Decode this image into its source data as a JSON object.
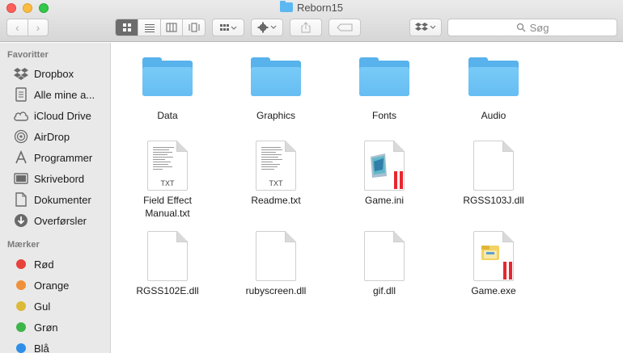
{
  "window": {
    "title": "Reborn15"
  },
  "toolbar": {
    "search_placeholder": "Søg",
    "back_icon": "chevron-left-icon",
    "forward_icon": "chevron-right-icon"
  },
  "sidebar": {
    "favorites_header": "Favoritter",
    "favorites": [
      {
        "label": "Dropbox",
        "icon": "dropbox-icon"
      },
      {
        "label": "Alle mine a...",
        "icon": "all-files-icon"
      },
      {
        "label": "iCloud Drive",
        "icon": "cloud-icon"
      },
      {
        "label": "AirDrop",
        "icon": "airdrop-icon"
      },
      {
        "label": "Programmer",
        "icon": "applications-icon"
      },
      {
        "label": "Skrivebord",
        "icon": "desktop-icon"
      },
      {
        "label": "Dokumenter",
        "icon": "documents-icon"
      },
      {
        "label": "Overførsler",
        "icon": "downloads-icon"
      }
    ],
    "tags_header": "Mærker",
    "tags": [
      {
        "label": "Rød",
        "color": "#e8413c"
      },
      {
        "label": "Orange",
        "color": "#f0913a"
      },
      {
        "label": "Gul",
        "color": "#dcb93a"
      },
      {
        "label": "Grøn",
        "color": "#3db54a"
      },
      {
        "label": "Blå",
        "color": "#2d8fe8"
      }
    ]
  },
  "files": [
    {
      "name": "Data",
      "kind": "folder"
    },
    {
      "name": "Graphics",
      "kind": "folder"
    },
    {
      "name": "Fonts",
      "kind": "folder"
    },
    {
      "name": "Audio",
      "kind": "folder"
    },
    {
      "name": "Field Effect Manual.txt",
      "kind": "txt",
      "ext": "TXT"
    },
    {
      "name": "Readme.txt",
      "kind": "txt",
      "ext": "TXT"
    },
    {
      "name": "Game.ini",
      "kind": "ini"
    },
    {
      "name": "RGSS103J.dll",
      "kind": "blank"
    },
    {
      "name": "RGSS102E.dll",
      "kind": "blank"
    },
    {
      "name": "rubyscreen.dll",
      "kind": "blank"
    },
    {
      "name": "gif.dll",
      "kind": "blank"
    },
    {
      "name": "Game.exe",
      "kind": "exe"
    }
  ],
  "colors": {
    "folder": "#58b2ec",
    "accent_red": "#e8262f"
  }
}
